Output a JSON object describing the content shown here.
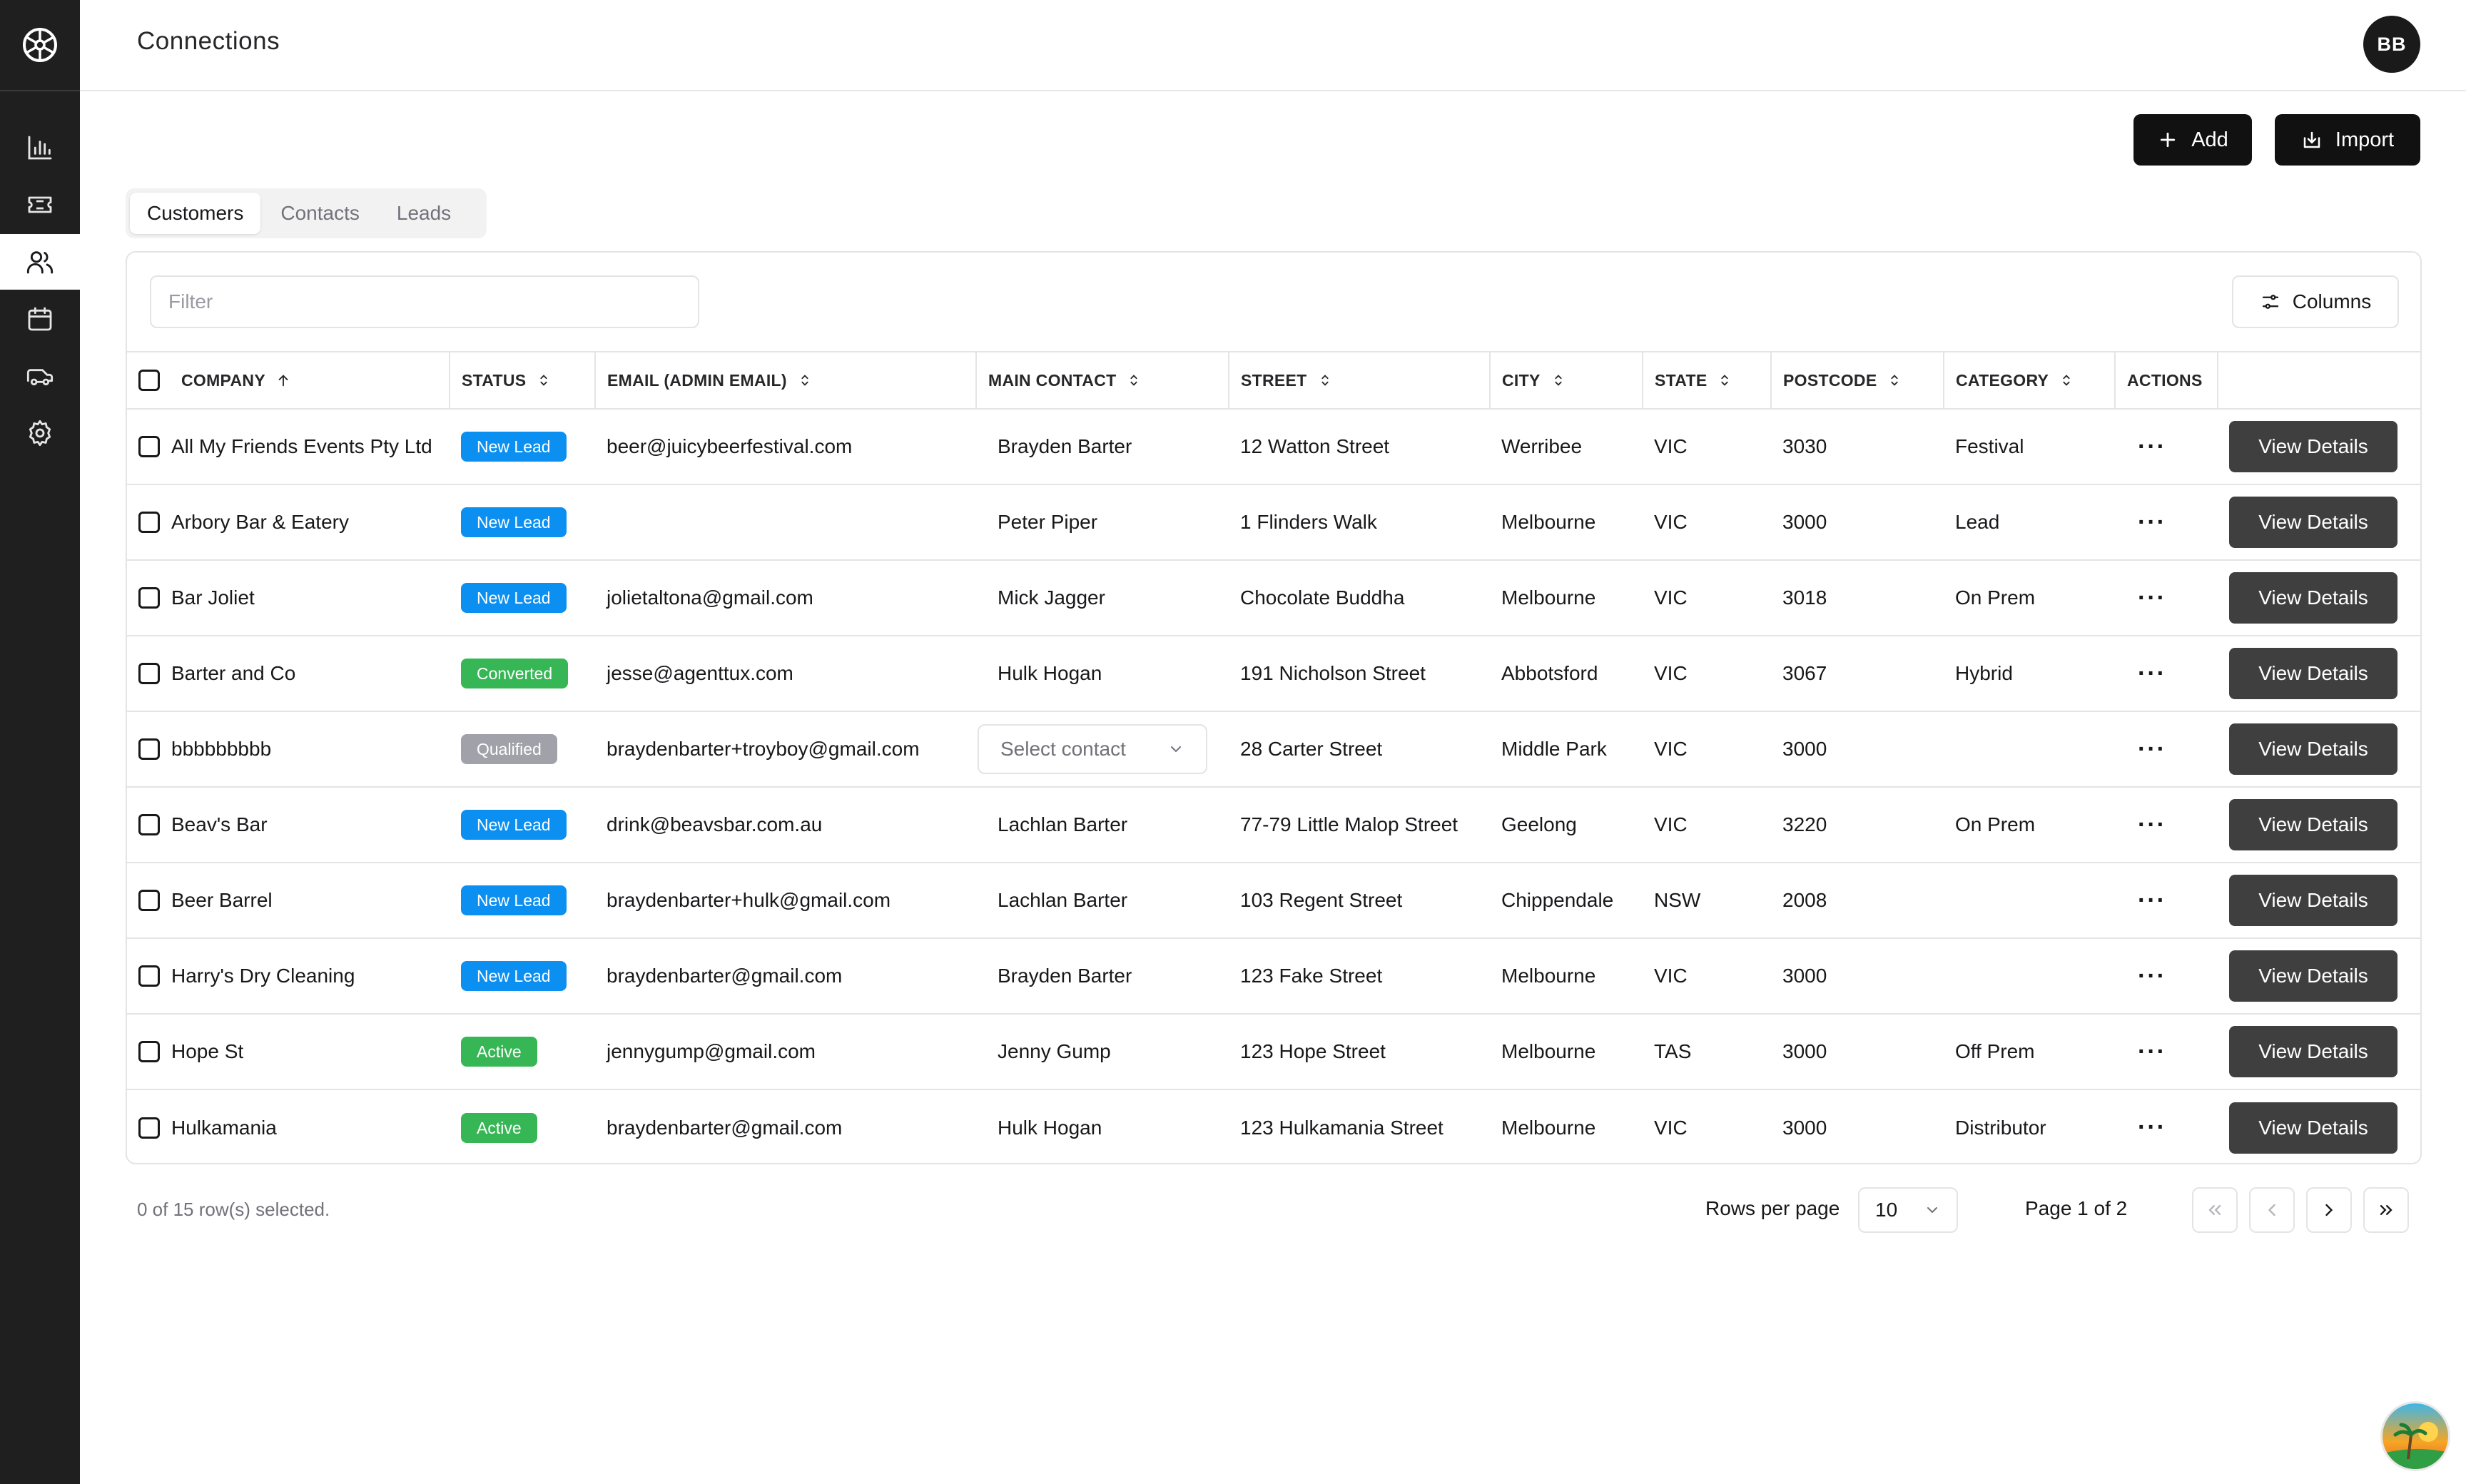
{
  "header": {
    "title": "Connections",
    "avatar_initials": "BB"
  },
  "sidebar": {
    "items": [
      {
        "icon": "bar-chart-icon"
      },
      {
        "icon": "ticket-icon"
      },
      {
        "icon": "users-icon",
        "active": true
      },
      {
        "icon": "calendar-icon"
      },
      {
        "icon": "truck-icon"
      },
      {
        "icon": "gear-icon"
      }
    ]
  },
  "toolbar": {
    "add_label": "Add",
    "import_label": "Import"
  },
  "tabs": [
    {
      "label": "Customers",
      "active": true
    },
    {
      "label": "Contacts"
    },
    {
      "label": "Leads"
    }
  ],
  "filter": {
    "placeholder": "Filter"
  },
  "columns_button": {
    "label": "Columns"
  },
  "table": {
    "headers": [
      "COMPANY",
      "STATUS",
      "EMAIL (ADMIN EMAIL)",
      "MAIN CONTACT",
      "STREET",
      "CITY",
      "STATE",
      "POSTCODE",
      "CATEGORY",
      "ACTIONS"
    ],
    "rows": [
      {
        "company": "All My Friends Events Pty Ltd",
        "status": "New Lead",
        "email": "beer@juicybeerfestival.com",
        "contact": "Brayden Barter",
        "street": "12 Watton Street",
        "city": "Werribee",
        "state": "VIC",
        "postcode": "3030",
        "category": "Festival"
      },
      {
        "company": "Arbory Bar & Eatery",
        "status": "New Lead",
        "email": "",
        "contact": "Peter Piper",
        "street": "1 Flinders Walk",
        "city": "Melbourne",
        "state": "VIC",
        "postcode": "3000",
        "category": "Lead"
      },
      {
        "company": "Bar Joliet",
        "status": "New Lead",
        "email": "jolietaltona@gmail.com",
        "contact": "Mick Jagger",
        "street": "Chocolate Buddha",
        "city": "Melbourne",
        "state": "VIC",
        "postcode": "3018",
        "category": "On Prem"
      },
      {
        "company": "Barter and Co",
        "status": "Converted",
        "email": "jesse@agenttux.com",
        "contact": "Hulk Hogan",
        "street": "191 Nicholson Street",
        "city": "Abbotsford",
        "state": "VIC",
        "postcode": "3067",
        "category": "Hybrid"
      },
      {
        "company": "bbbbbbbbb",
        "status": "Qualified",
        "email": "braydenbarter+troyboy@gmail.com",
        "contact": "",
        "street": "28 Carter Street",
        "city": "Middle Park",
        "state": "VIC",
        "postcode": "3000",
        "category": ""
      },
      {
        "company": "Beav's Bar",
        "status": "New Lead",
        "email": "drink@beavsbar.com.au",
        "contact": "Lachlan Barter",
        "street": "77-79 Little Malop Street",
        "city": "Geelong",
        "state": "VIC",
        "postcode": "3220",
        "category": "On Prem"
      },
      {
        "company": "Beer Barrel",
        "status": "New Lead",
        "email": "braydenbarter+hulk@gmail.com",
        "contact": "Lachlan Barter",
        "street": "103 Regent Street",
        "city": "Chippendale",
        "state": "NSW",
        "postcode": "2008",
        "category": ""
      },
      {
        "company": "Harry's Dry Cleaning",
        "status": "New Lead",
        "email": "braydenbarter@gmail.com",
        "contact": "Brayden Barter",
        "street": "123 Fake Street",
        "city": "Melbourne",
        "state": "VIC",
        "postcode": "3000",
        "category": ""
      },
      {
        "company": "Hope St",
        "status": "Active",
        "email": "jennygump@gmail.com",
        "contact": "Jenny Gump",
        "street": "123 Hope Street",
        "city": "Melbourne",
        "state": "TAS",
        "postcode": "3000",
        "category": "Off Prem"
      },
      {
        "company": "Hulkamania",
        "status": "Active",
        "email": "braydenbarter@gmail.com",
        "contact": "Hulk Hogan",
        "street": "123 Hulkamania Street",
        "city": "Melbourne",
        "state": "VIC",
        "postcode": "3000",
        "category": "Distributor"
      }
    ],
    "select_contact_placeholder": "Select contact",
    "view_details_label": "View Details",
    "actions_glyph": "···"
  },
  "footer": {
    "selected_text": "0 of 15 row(s) selected.",
    "rows_per_page_label": "Rows per page",
    "rows_per_page_value": "10",
    "page_text": "Page 1 of 2"
  },
  "colors": {
    "new_lead": "#0b8ff0",
    "converted": "#37b656",
    "qualified": "#a1a1aa",
    "active": "#37b656",
    "sidebar": "#1f1f1f"
  }
}
